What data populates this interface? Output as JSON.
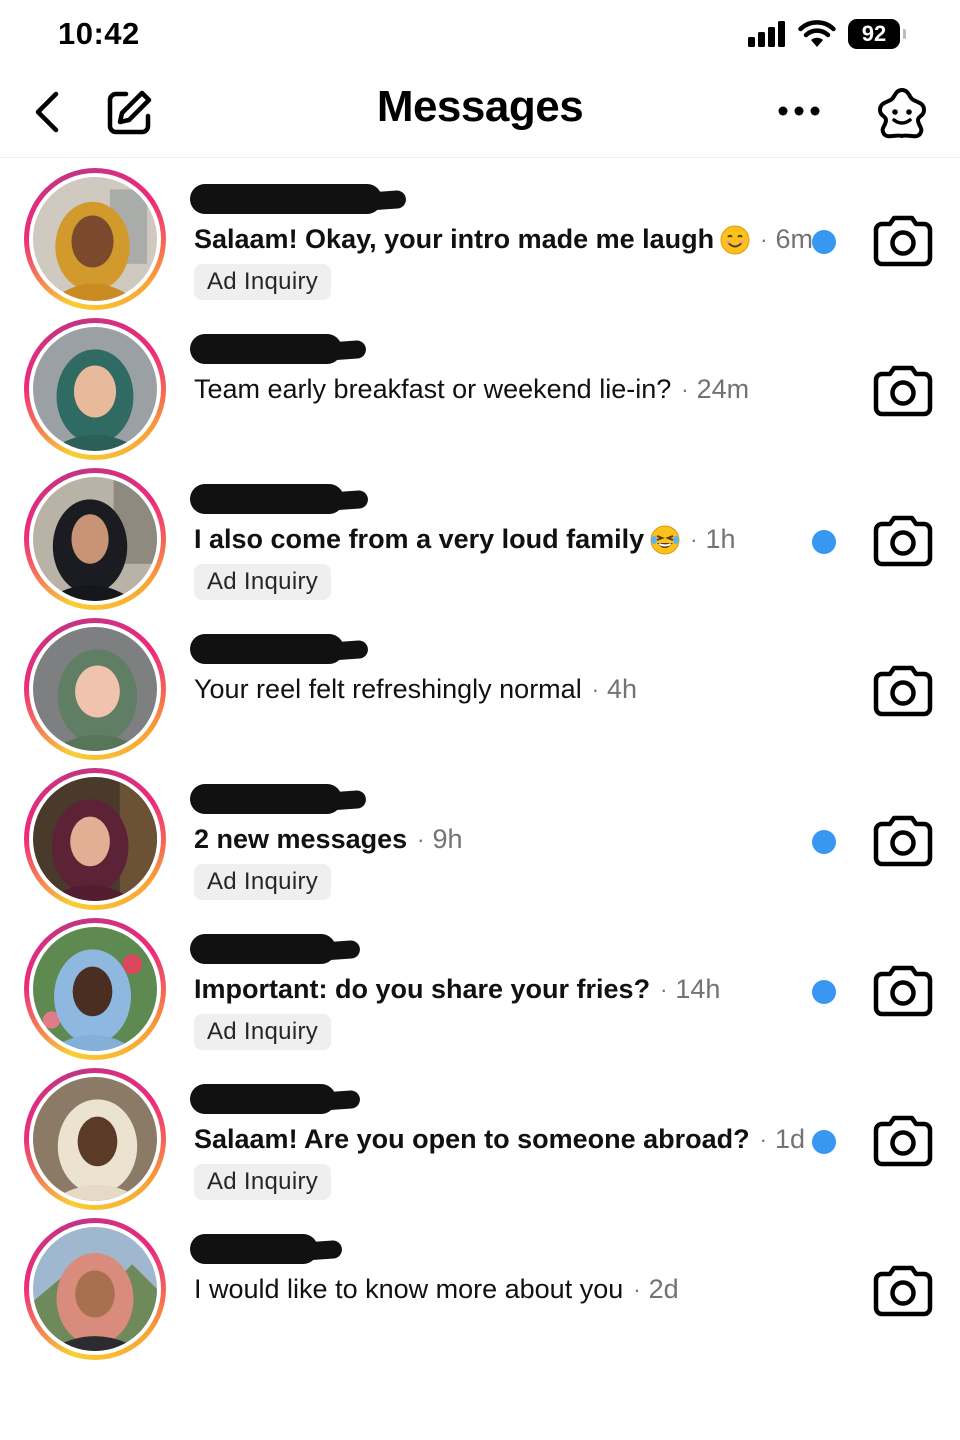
{
  "status_bar": {
    "time": "10:42",
    "battery": "92"
  },
  "header": {
    "title": "Messages"
  },
  "conversations": [
    {
      "message": "Salaam! Okay, your intro made me laugh",
      "emoji": "smiling-face-emoji",
      "time": "6m",
      "tag": "Ad Inquiry",
      "unread": true
    },
    {
      "message": "Team early breakfast or weekend lie-in?",
      "time": "24m",
      "unread": false
    },
    {
      "message": "I also come from a very loud family",
      "emoji": "laughing-tears-emoji",
      "time": "1h",
      "tag": "Ad Inquiry",
      "unread": true
    },
    {
      "message": "Your reel felt refreshingly normal",
      "time": "4h",
      "unread": false
    },
    {
      "message": "2 new messages",
      "time": "9h",
      "tag": "Ad Inquiry",
      "unread": true
    },
    {
      "message": "Important: do you share your fries?",
      "time": "14h",
      "tag": "Ad Inquiry",
      "unread": true
    },
    {
      "message": "Salaam! Are you open to someone abroad?",
      "time": "1d",
      "tag": "Ad Inquiry",
      "unread": true
    },
    {
      "message": "I would like to know more about you",
      "time": "2d",
      "unread": false
    }
  ],
  "colors": {
    "unread_dot": "#3897f0",
    "secondary_text": "#737373",
    "tag_bg": "#efefef"
  }
}
